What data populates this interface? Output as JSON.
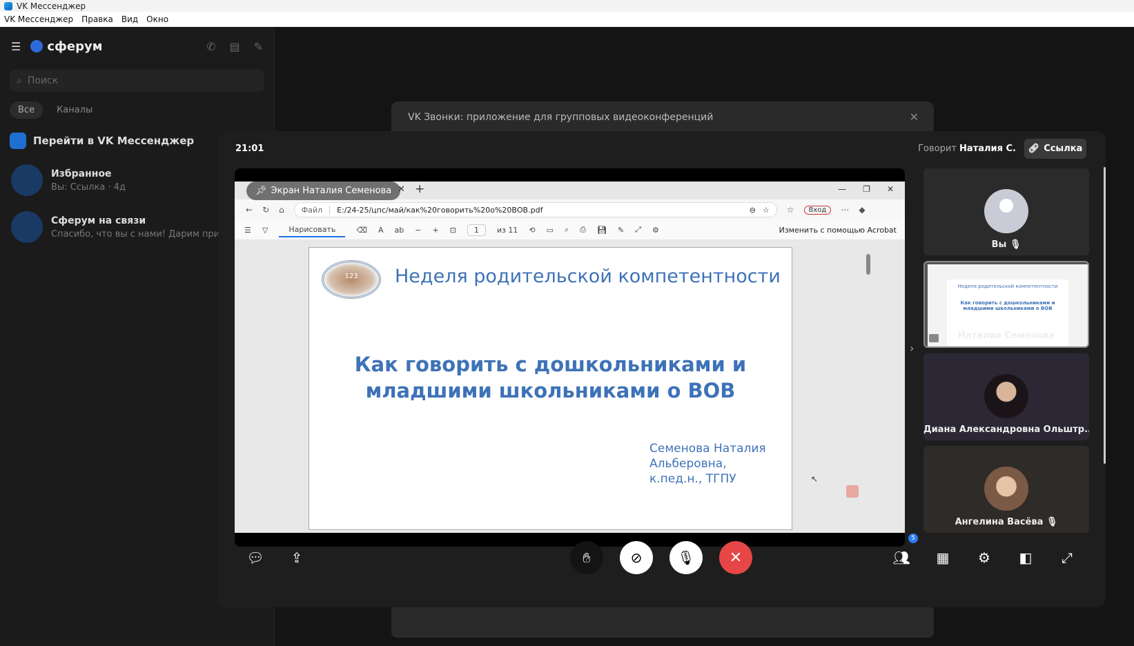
{
  "window": {
    "title": "VK Мессенджер"
  },
  "menu": [
    "VK Мессенджер",
    "Правка",
    "Вид",
    "Окно"
  ],
  "sidebar": {
    "brand": "сферум",
    "search_placeholder": "Поиск",
    "tabs": [
      "Все",
      "Каналы"
    ],
    "goto_label": "Перейти в VK Мессенджер",
    "chats": [
      {
        "name": "Избранное",
        "preview": "Вы: Ссылка · 4д"
      },
      {
        "name": "Сферум на связи",
        "preview": "Спасибо, что вы с нами! Дарим прие"
      }
    ]
  },
  "banner": {
    "text": "VK Звонки: приложение для групповых видеоконференций"
  },
  "call": {
    "time": "21:01",
    "speaking_label": "Говорит",
    "speaker": "Наталия С.",
    "link_label": "Ссылка",
    "participants_count": "5",
    "share": {
      "pill_label": "Экран Наталия Семенова",
      "url_prefix": "Файл",
      "url": "E:/24-25/цпс/май/как%20говорить%20о%20ВОВ.pdf",
      "login": "Вход",
      "draw_label": "Нарисовать",
      "page": "1",
      "page_of": "из 11",
      "edit_acrobat": "Изменить с помощью Acrobat",
      "slide": {
        "seal_text": "123",
        "top_title": "Неделя родительской компетентности",
        "heading_line1": "Как говорить с  дошкольниками и",
        "heading_line2": "младшими школьниками о ВОВ",
        "author_line1": "Семенова Наталия",
        "author_line2": "Альберовна,",
        "author_line3": "к.пед.н., ТГПУ"
      }
    },
    "tiles": [
      {
        "name": "Вы",
        "muted": true,
        "avatar": "user-placeholder-icon"
      },
      {
        "name": "Наталия Семенова",
        "muted": false,
        "avatar": "screen-share-thumbnail",
        "thumb_title": "Неделя родительской компетентности",
        "thumb_heading": "Как говорить с  дошкольниками и младшими школьниками о ВОВ"
      },
      {
        "name": "Диана Александровна Ольштр...",
        "muted": true,
        "avatar": "photo",
        "color": "#2a2230"
      },
      {
        "name": "Ангелина Васёва",
        "muted": true,
        "avatar": "photo",
        "color": "#3a2c24"
      }
    ],
    "colors": {
      "end_call": "#e64646",
      "badge": "#2a7bf0",
      "accent_text": "#3e72b8"
    }
  }
}
